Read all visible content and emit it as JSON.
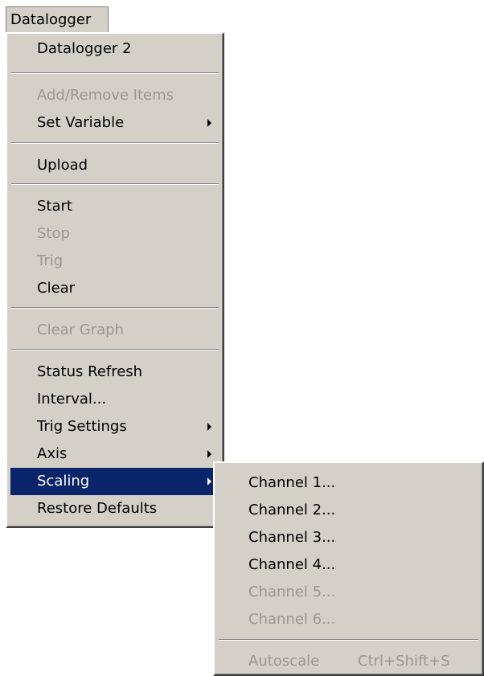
{
  "menubar": {
    "label": "Datalogger"
  },
  "main_menu": {
    "items": [
      {
        "label": "Datalogger 2"
      },
      {
        "label": "Add/Remove Items"
      },
      {
        "label": "Set Variable"
      },
      {
        "label": "Upload"
      },
      {
        "label": "Start"
      },
      {
        "label": "Stop"
      },
      {
        "label": "Trig"
      },
      {
        "label": "Clear"
      },
      {
        "label": "Clear Graph"
      },
      {
        "label": "Status Refresh"
      },
      {
        "label": "Interval..."
      },
      {
        "label": "Trig Settings"
      },
      {
        "label": "Axis"
      },
      {
        "label": "Scaling"
      },
      {
        "label": "Restore Defaults"
      }
    ]
  },
  "sub_menu": {
    "items": [
      {
        "label": "Channel 1..."
      },
      {
        "label": "Channel 2..."
      },
      {
        "label": "Channel 3..."
      },
      {
        "label": "Channel 4..."
      },
      {
        "label": "Channel 5..."
      },
      {
        "label": "Channel 6..."
      },
      {
        "label": "Autoscale",
        "shortcut": "Ctrl+Shift+S"
      }
    ]
  },
  "colors": {
    "menu_bg": "#d4d0c8",
    "highlight": "#0a246a",
    "disabled_text": "#9a978f"
  }
}
